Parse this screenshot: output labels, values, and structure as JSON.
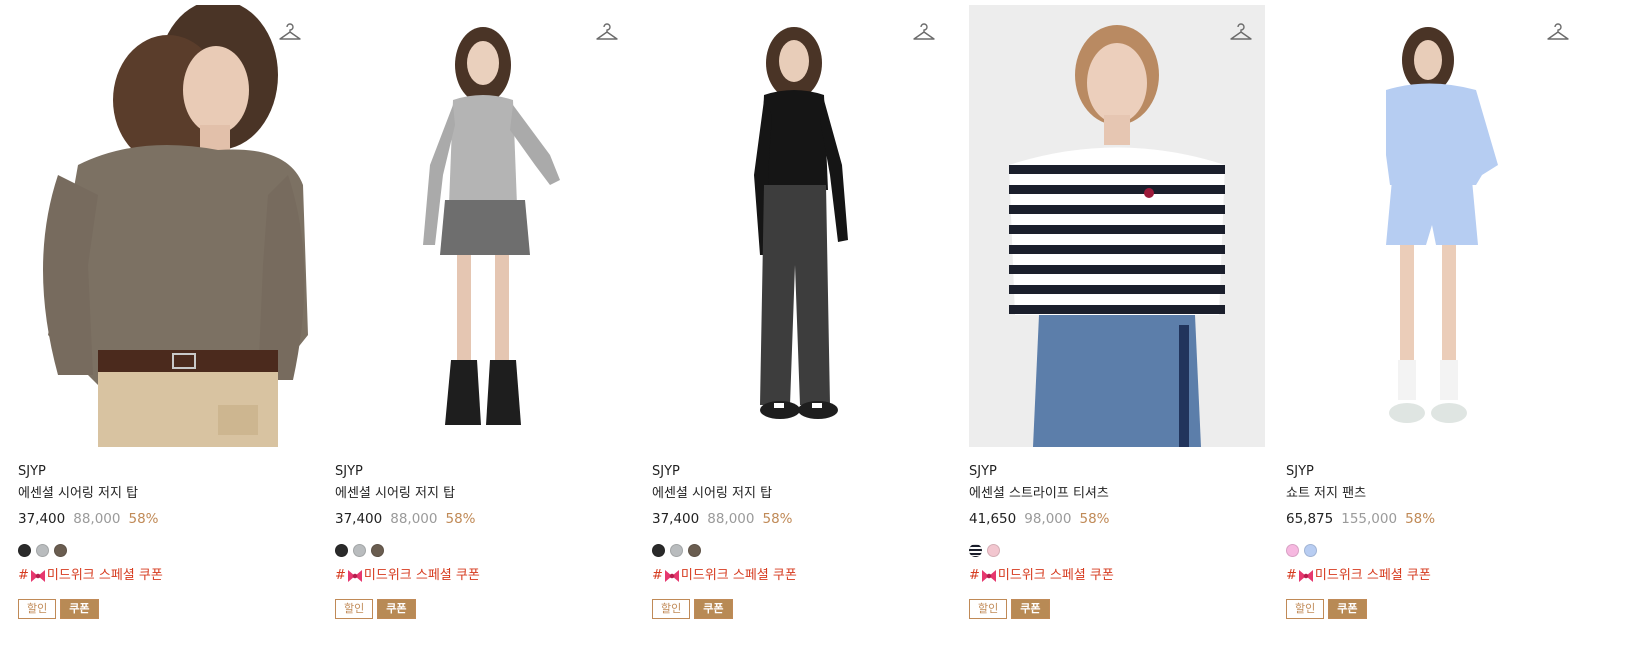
{
  "colors": {
    "accent": "#c08a57",
    "coupon_text": "#d63b1f",
    "discount_rate": "#c08a57",
    "original_price": "#9a9a9a"
  },
  "products": [
    {
      "brand": "SJYP",
      "name": "에센셜 시어링 저지 탑",
      "price": "37,400",
      "original_price": "88,000",
      "discount": "58%",
      "swatches": [
        "#2a2a2a",
        "#b9bcbe",
        "#6a5d50"
      ],
      "tag_prefix": "#",
      "tag_text": "미드위크 스페셜 쿠폰",
      "badge_sale": "할인",
      "badge_coupon": "쿠폰",
      "icon": "hanger-icon"
    },
    {
      "brand": "SJYP",
      "name": "에센셜 시어링 저지 탑",
      "price": "37,400",
      "original_price": "88,000",
      "discount": "58%",
      "swatches": [
        "#2a2a2a",
        "#b9bcbe",
        "#6a5d50"
      ],
      "tag_prefix": "#",
      "tag_text": "미드위크 스페셜 쿠폰",
      "badge_sale": "할인",
      "badge_coupon": "쿠폰",
      "icon": "hanger-icon"
    },
    {
      "brand": "SJYP",
      "name": "에센셜 시어링 저지 탑",
      "price": "37,400",
      "original_price": "88,000",
      "discount": "58%",
      "swatches": [
        "#2a2a2a",
        "#b9bcbe",
        "#6a5d50"
      ],
      "tag_prefix": "#",
      "tag_text": "미드위크 스페셜 쿠폰",
      "badge_sale": "할인",
      "badge_coupon": "쿠폰",
      "icon": "hanger-icon"
    },
    {
      "brand": "SJYP",
      "name": "에센셜 스트라이프 티셔츠",
      "price": "41,650",
      "original_price": "98,000",
      "discount": "58%",
      "swatches": [
        "stripe",
        "#f2c6cf"
      ],
      "tag_prefix": "#",
      "tag_text": "미드위크 스페셜 쿠폰",
      "badge_sale": "할인",
      "badge_coupon": "쿠폰",
      "icon": "hanger-icon"
    },
    {
      "brand": "SJYP",
      "name": "쇼트 저지 팬츠",
      "price": "65,875",
      "original_price": "155,000",
      "discount": "58%",
      "swatches": [
        "#f6b8e0",
        "#b8cdf2"
      ],
      "tag_prefix": "#",
      "tag_text": "미드위크 스페셜 쿠폰",
      "badge_sale": "할인",
      "badge_coupon": "쿠폰",
      "icon": "hanger-icon"
    }
  ]
}
